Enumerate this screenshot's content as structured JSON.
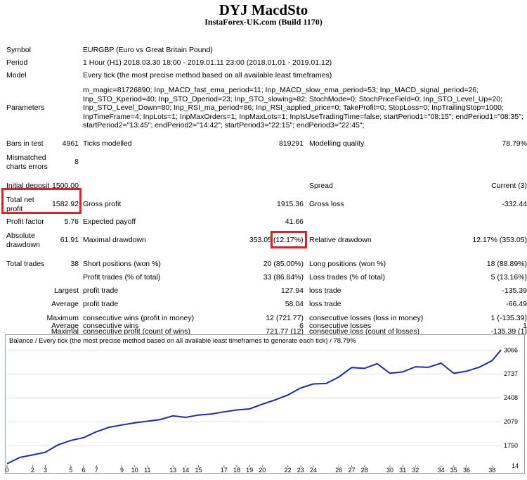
{
  "header": {
    "title": "DYJ MacdSto",
    "subtitle": "InstaForex-UK.com (Build 1170)"
  },
  "info": {
    "symbol_label": "Symbol",
    "symbol_value": "EURGBP (Euro vs Great Britain Pound)",
    "period_label": "Period",
    "period_value": "1 Hour (H1) 2018.03.30 18:00 - 2019.01.11 23:00 (2018.01.01 - 2019.01.12)",
    "model_label": "Model",
    "model_value": "Every tick (the most precise method based on all available least timeframes)",
    "parameters_label": "Parameters",
    "parameters_value": "m_magic=81726890; Inp_MACD_fast_ema_period=11; Inp_MACD_slow_ema_period=53; Inp_MACD_signal_period=26; Inp_STO_Kperiod=40; Inp_STO_Dperiod=23; Inp_STO_slowing=82; StochMode=0; StochPriceField=0; Inp_STO_Level_Up=20; Inp_STO_Level_Down=80; Inp_RSI_ma_period=86; Inp_RSI_applied_price=0; TakeProfit=0; StopLoss=0; InpTrailingStop=1000; InpTimeFrame=4; InpLots=1; InpMaxOrders=1; InpMaxLots=1; InpIsUseTradingTime=false; startPeriod1=\"08:15\"; endPeriod1=\"08:35\"; startPeriod2=\"13:45\"; endPeriod2=\"14:42\"; startPeriod3=\"22:15\"; endPeriod3=\"22:45\";"
  },
  "stats": {
    "bars_label": "Bars in test",
    "bars_value": "4961",
    "ticks_label": "Ticks modelled",
    "ticks_value": "819291",
    "quality_label": "Modelling quality",
    "quality_value": "78.79%",
    "mismatch_label_1": "Mismatched",
    "mismatch_label_2": "charts errors",
    "mismatch_value": "8",
    "deposit_label": "Initial deposit",
    "deposit_value": "1500.00",
    "spread_label": "Spread",
    "spread_value": "Current (3)",
    "netprofit_label_1": "Total net",
    "netprofit_label_2": "profit",
    "netprofit_value": "1582.92",
    "grossprofit_label": "Gross profit",
    "grossprofit_value": "1915.36",
    "grossloss_label": "Gross loss",
    "grossloss_value": "-332.44",
    "pf_label": "Profit factor",
    "pf_value": "5.76",
    "payoff_label": "Expected payoff",
    "payoff_value": "41.66",
    "absdd_label_1": "Absolute",
    "absdd_label_2": "drawdown",
    "absdd_value": "61.91",
    "maxdd_label": "Maximal drawdown",
    "maxdd_value": "353.05",
    "maxdd_pct": "(12.17%)",
    "reldd_label": "Relative drawdown",
    "reldd_value": "12.17% (353.05)",
    "trades_label": "Total trades",
    "trades_value": "38",
    "short_label": "Short positions (won %)",
    "short_value": "20 (85.00%)",
    "long_label": "Long positions (won %)",
    "long_value": "18 (88.89%)",
    "ptrades_label": "Profit trades (% of total)",
    "ptrades_value": "33 (86.84%)",
    "ltrades_label": "Loss trades (% of total)",
    "ltrades_value": "5 (13.16%)",
    "largest_label": "Largest",
    "largest_pt_label": "profit trade",
    "largest_pt_value": "127.94",
    "largest_lt_label": "loss trade",
    "largest_lt_value": "-135.39",
    "average_label": "Average",
    "average_pt_label": "profit trade",
    "average_pt_value": "58.04",
    "average_lt_label": "loss trade",
    "average_lt_value": "-66.49",
    "maximum_label": "Maximum",
    "cwins_label": "consecutive wins (profit in money)",
    "cwins_value": "12 (721.77)",
    "closs_label": "consecutive losses (loss in money)",
    "closs_value": "1 (-135.39)",
    "maximal_label": "Maximal",
    "cprofit_label": "consecutive profit (count of wins)",
    "cprofit_value": "721.77 (12)",
    "closscount_label": "consecutive loss (count of losses)",
    "closscount_value": "-135.39 (1)",
    "average2_label": "Average",
    "avgwins_label": "consecutive wins",
    "avgwins_value": "6",
    "avgloss_label": "consecutive losses",
    "avgloss_value": "1"
  },
  "colors": {
    "highlight": "#e21f26",
    "line": "#1e2ba8"
  },
  "chart_data": {
    "type": "line",
    "title": "Balance / Every tick (the most precise method based on all available least timeframes to generate each tick) / 78.79%",
    "x_ticks": [
      0,
      2,
      3,
      5,
      6,
      7,
      9,
      10,
      11,
      13,
      14,
      15,
      17,
      18,
      19,
      20,
      22,
      23,
      24,
      26,
      27,
      28,
      30,
      31,
      32,
      34,
      35,
      36,
      38
    ],
    "y_ticks": [
      3066,
      2737,
      2408,
      2079,
      1750
    ],
    "y_label_cut": "14",
    "xlim": [
      0,
      38.7
    ],
    "ylim": [
      1480,
      3117
    ],
    "x": [
      0,
      1,
      2,
      3,
      4,
      5,
      6,
      7,
      8,
      9,
      10,
      11,
      12,
      13,
      14,
      15,
      16,
      17,
      18,
      19,
      20,
      21,
      22,
      23,
      24,
      25,
      26,
      27,
      28,
      29,
      30,
      31,
      32,
      33,
      34,
      35,
      36,
      37,
      38,
      38.7
    ],
    "values": [
      1500,
      1588,
      1621,
      1658,
      1760,
      1821,
      1860,
      1941,
      2002,
      2034,
      2063,
      2085,
      2109,
      2159,
      2139,
      2171,
      2184,
      2214,
      2240,
      2255,
      2320,
      2379,
      2446,
      2543,
      2599,
      2605,
      2695,
      2824,
      2813,
      2877,
      2745,
      2764,
      2835,
      2827,
      2885,
      2745,
      2774,
      2829,
      2919,
      3066
    ]
  }
}
